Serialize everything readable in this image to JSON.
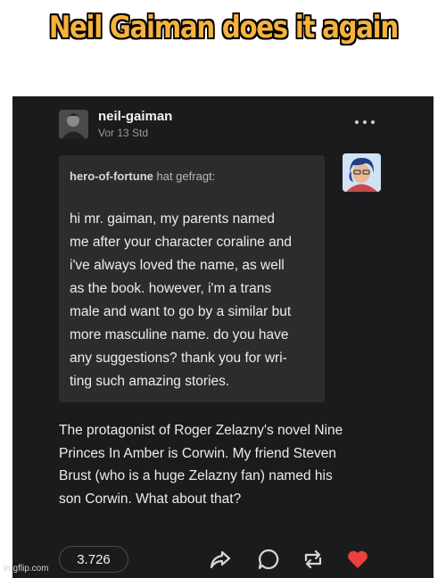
{
  "caption": {
    "text": "Neil Gaiman does it again",
    "color": "#f6b23c"
  },
  "post": {
    "username": "neil-gaiman",
    "timestamp": "Vor 13 Std",
    "ask": {
      "asker": "hero-of-fortune",
      "verb": "hat gefragt:",
      "lines": [
        "hi mr. gaiman, my parents named",
        "me after your character coraline and",
        "i've always loved the name, as well",
        "as the book. however, i'm a trans",
        "male and want to go by a similar but",
        "more masculine name. do you have",
        "any suggestions? thank you for wri-",
        "ting such amazing stories."
      ]
    },
    "answer_lines": [
      "The protagonist of Roger Zelazny's novel Nine",
      "Princes In Amber is Corwin. My friend Steven",
      "Brust (who is a huge Zelazny fan) named his",
      "son Corwin. What about that?"
    ],
    "notes_count": "3.726",
    "icons": {
      "more": "more-options-icon",
      "share": "share-icon",
      "reply": "reply-icon",
      "reblog": "reblog-icon",
      "like": "heart-icon"
    },
    "colors": {
      "background": "#1b1b1d",
      "ask_box": "#2c2c2e",
      "like": "#e8423b"
    }
  },
  "watermark": "imgflip.com"
}
